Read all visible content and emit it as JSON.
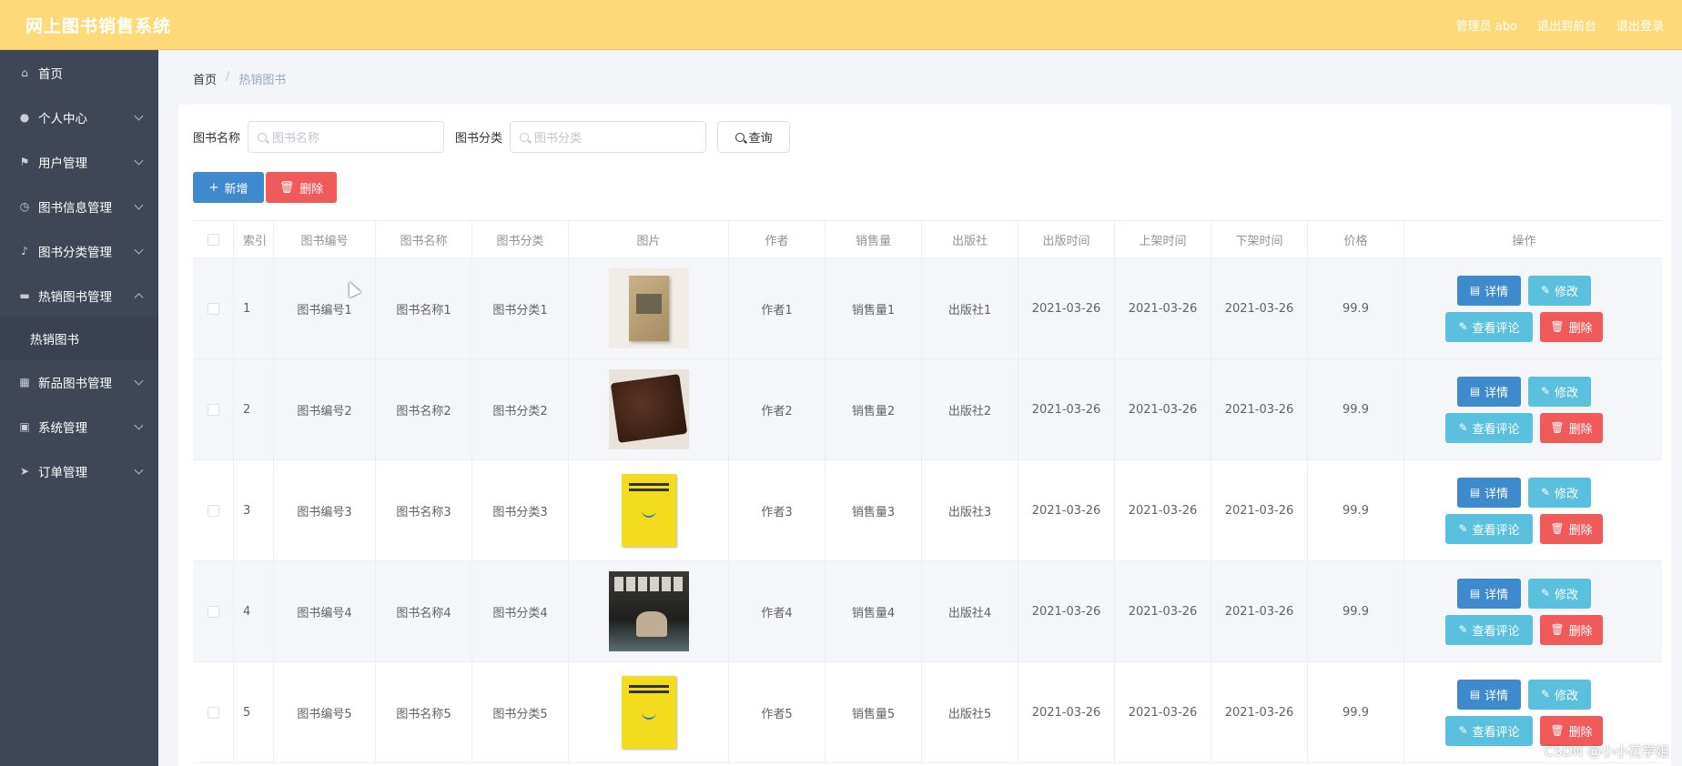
{
  "header": {
    "title": "网上图书销售系统",
    "admin": "管理员 abo",
    "back_front": "退出到前台",
    "logout": "退出登录"
  },
  "sidebar": {
    "items": [
      {
        "label": "首页",
        "icon": "home-icon"
      },
      {
        "label": "个人中心",
        "icon": "user-icon"
      },
      {
        "label": "用户管理",
        "icon": "flag-icon"
      },
      {
        "label": "图书信息管理",
        "icon": "clock-icon"
      },
      {
        "label": "图书分类管理",
        "icon": "bell-icon"
      },
      {
        "label": "热销图书管理",
        "icon": "briefcase-icon",
        "expanded": true,
        "children": [
          {
            "label": "热销图书"
          }
        ]
      },
      {
        "label": "新品图书管理",
        "icon": "grid-icon"
      },
      {
        "label": "系统管理",
        "icon": "suitcase-icon"
      },
      {
        "label": "订单管理",
        "icon": "paper-plane-icon"
      }
    ]
  },
  "breadcrumb": {
    "home": "首页",
    "sep": "/",
    "current": "热销图书"
  },
  "search": {
    "name_label": "图书名称",
    "name_placeholder": "图书名称",
    "cat_label": "图书分类",
    "cat_placeholder": "图书分类",
    "query_label": "查询"
  },
  "actions": {
    "add": "新增",
    "delete": "删除"
  },
  "table": {
    "headers": [
      "索引",
      "图书编号",
      "图书名称",
      "图书分类",
      "图片",
      "作者",
      "销售量",
      "出版社",
      "出版时间",
      "上架时间",
      "下架时间",
      "价格",
      "操作"
    ],
    "rows": [
      {
        "idx": "1",
        "no": "图书编号1",
        "name": "图书名称1",
        "cat": "图书分类1",
        "author": "作者1",
        "sales": "销售量1",
        "pub": "出版社1",
        "pdate": "2021-03-26",
        "on": "2021-03-26",
        "off": "2021-03-26",
        "price": "99.9"
      },
      {
        "idx": "2",
        "no": "图书编号2",
        "name": "图书名称2",
        "cat": "图书分类2",
        "author": "作者2",
        "sales": "销售量2",
        "pub": "出版社2",
        "pdate": "2021-03-26",
        "on": "2021-03-26",
        "off": "2021-03-26",
        "price": "99.9"
      },
      {
        "idx": "3",
        "no": "图书编号3",
        "name": "图书名称3",
        "cat": "图书分类3",
        "author": "作者3",
        "sales": "销售量3",
        "pub": "出版社3",
        "pdate": "2021-03-26",
        "on": "2021-03-26",
        "off": "2021-03-26",
        "price": "99.9"
      },
      {
        "idx": "4",
        "no": "图书编号4",
        "name": "图书名称4",
        "cat": "图书分类4",
        "author": "作者4",
        "sales": "销售量4",
        "pub": "出版社4",
        "pdate": "2021-03-26",
        "on": "2021-03-26",
        "off": "2021-03-26",
        "price": "99.9"
      },
      {
        "idx": "5",
        "no": "图书编号5",
        "name": "图书名称5",
        "cat": "图书分类5",
        "author": "作者5",
        "sales": "销售量5",
        "pub": "出版社5",
        "pdate": "2021-03-26",
        "on": "2021-03-26",
        "off": "2021-03-26",
        "price": "99.9"
      }
    ],
    "row_ops": {
      "detail": "详情",
      "edit": "修改",
      "review": "查看评论",
      "remove": "删除"
    }
  },
  "watermark": "CSDN @小小花学姐",
  "colors": {
    "header_bg": "#fdd97a",
    "sidebar_bg": "#3f4756",
    "primary": "#3f89cd",
    "info": "#5bc0de",
    "danger": "#f05a5a"
  }
}
